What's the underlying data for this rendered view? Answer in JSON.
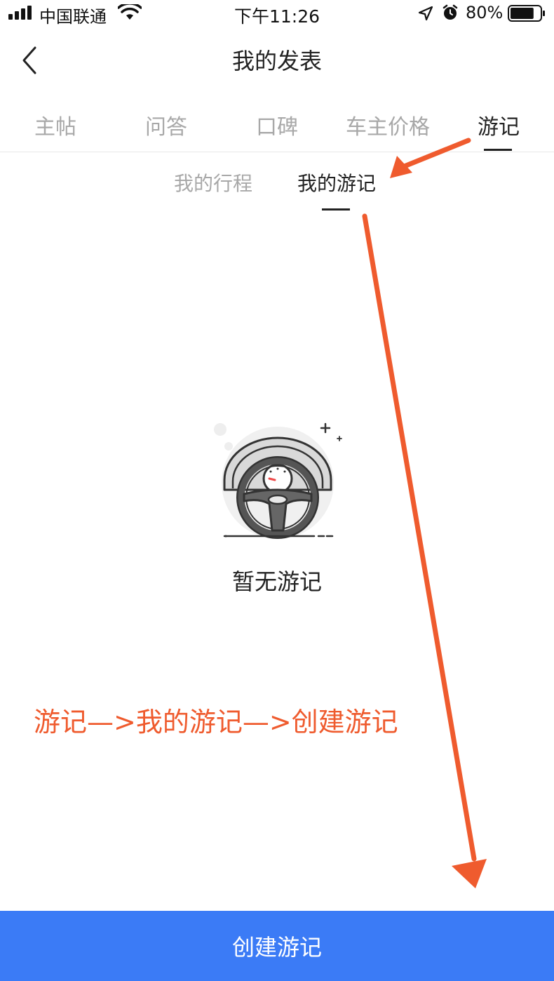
{
  "status_bar": {
    "carrier": "中国联通",
    "time": "下午11:26",
    "battery_percent": "80%",
    "battery_level": 0.8,
    "icons": [
      "signal-icon",
      "wifi-icon",
      "location-icon",
      "alarm-icon",
      "battery-icon"
    ]
  },
  "nav": {
    "back_icon": "chevron-left-icon",
    "title": "我的发表"
  },
  "main_tabs": [
    {
      "label": "主帖",
      "active": false
    },
    {
      "label": "问答",
      "active": false
    },
    {
      "label": "口碑",
      "active": false
    },
    {
      "label": "车主价格",
      "active": false
    },
    {
      "label": "游记",
      "active": true
    }
  ],
  "sub_tabs": [
    {
      "label": "我的行程",
      "active": false
    },
    {
      "label": "我的游记",
      "active": true
    }
  ],
  "empty_state": {
    "icon": "steering-wheel-icon",
    "text": "暂无游记"
  },
  "annotation": {
    "text": "游记—>我的游记—>创建游记",
    "color": "#ef5b2e"
  },
  "create_button": {
    "label": "创建游记",
    "color": "#3b7bf6"
  }
}
